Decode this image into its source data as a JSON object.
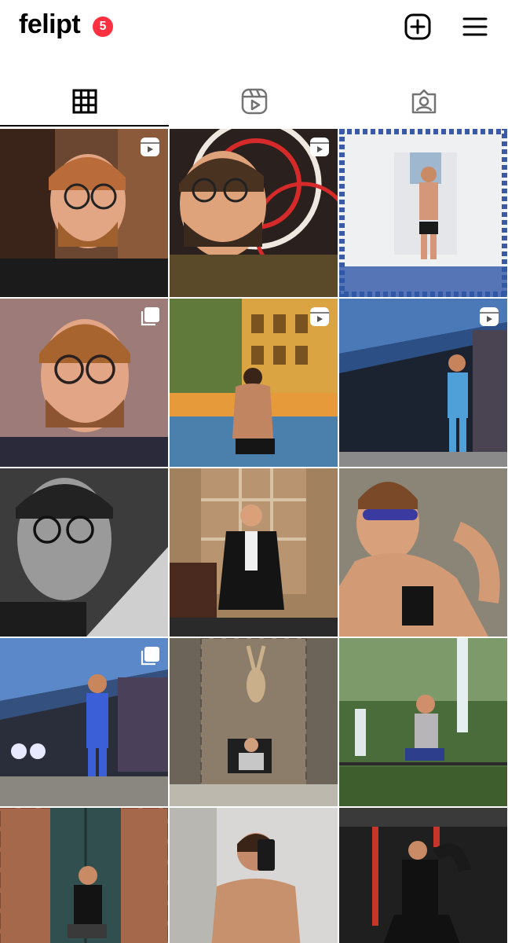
{
  "header": {
    "username": "felipt",
    "notification_count": "5",
    "create_icon": "plus-square-icon",
    "menu_icon": "hamburger-menu-icon"
  },
  "tabs": [
    {
      "name": "posts",
      "icon": "grid-icon",
      "active": true
    },
    {
      "name": "reels",
      "icon": "reels-icon",
      "active": false
    },
    {
      "name": "tagged",
      "icon": "tagged-icon",
      "active": false
    }
  ],
  "posts": [
    {
      "type": "reel",
      "scene": "selfie-warm-room"
    },
    {
      "type": "reel",
      "scene": "selfie-neon-rings"
    },
    {
      "type": "photo",
      "scene": "mirror-selfie-tiled-bathroom"
    },
    {
      "type": "carousel",
      "scene": "studio-portrait"
    },
    {
      "type": "reel",
      "scene": "poolside-back-view"
    },
    {
      "type": "reel",
      "scene": "blue-suit-corridor"
    },
    {
      "type": "photo",
      "scene": "black-and-white-selfie"
    },
    {
      "type": "photo",
      "scene": "suit-seated-wood-shelves"
    },
    {
      "type": "photo",
      "scene": "sunglasses-sunbathing"
    },
    {
      "type": "carousel",
      "scene": "blue-suit-full-body"
    },
    {
      "type": "photo",
      "scene": "stone-wall-deer-head"
    },
    {
      "type": "photo",
      "scene": "waterfall-jungle"
    },
    {
      "type": "photo",
      "scene": "brick-wall-door"
    },
    {
      "type": "photo",
      "scene": "shirtless-mirror-selfie"
    },
    {
      "type": "photo",
      "scene": "gym-flex-pose"
    }
  ],
  "colors": {
    "badge": "#ff3040",
    "icon": "#000000",
    "inactive_icon": "#737373"
  }
}
